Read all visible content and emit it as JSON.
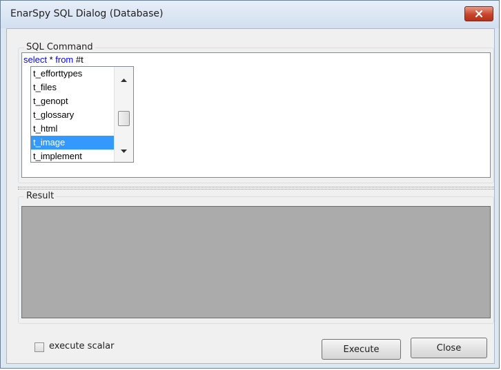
{
  "window": {
    "title": "EnarSpy SQL Dialog (Database)"
  },
  "sql_group": {
    "label": "SQL Command",
    "command": {
      "keyword1": "select",
      "star": " * ",
      "keyword2": "from",
      "rest": " #t"
    },
    "autocomplete_items": [
      "t_efforttypes",
      "t_files",
      "t_genopt",
      "t_glossary",
      "t_html",
      "t_image",
      "t_implement"
    ],
    "selected_item": "t_image"
  },
  "result_group": {
    "label": "Result"
  },
  "options": {
    "execute_scalar_label": "execute scalar",
    "execute_scalar_checked": false
  },
  "buttons": {
    "execute": "Execute",
    "close": "Close"
  },
  "icons": {
    "close": "close-icon",
    "scroll_up": "arrow-up-icon",
    "scroll_down": "arrow-down-icon"
  },
  "colors": {
    "keyword": "#0000ff",
    "selection": "#3399ff",
    "result_background": "#ababab",
    "close_button": "#c8442b"
  }
}
